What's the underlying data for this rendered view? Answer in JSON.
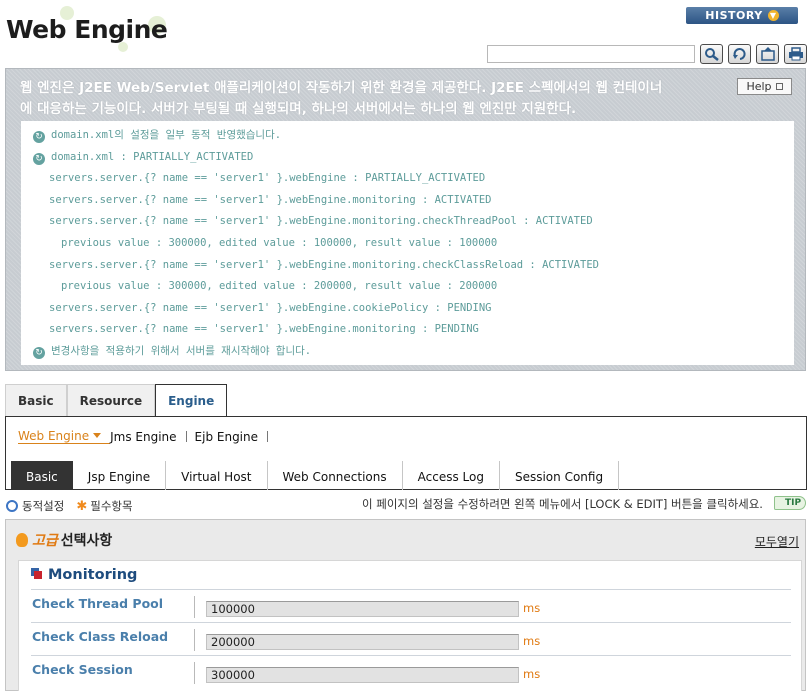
{
  "header": {
    "title": "Web Engine",
    "history_label": "HISTORY",
    "search_value": "",
    "toolbar_icons": [
      "search-icon",
      "refresh-icon",
      "export-icon",
      "print-icon"
    ]
  },
  "description": {
    "lines": [
      "웹 엔진은 J2EE Web/Servlet 애플리케이션이 작동하기 위한 환경을 제공한다. J2EE 스펙에서의 웹 컨테이너",
      "에 대응하는 기능이다. 서버가 부팅될 때 실행되며, 하나의 서버에서는 하나의 웹 엔진만 지원한다."
    ],
    "help_label": "Help"
  },
  "messages": [
    {
      "icon": true,
      "indent": 0,
      "text": "domain.xml의 설정을 일부 동적 반영했습니다."
    },
    {
      "icon": true,
      "indent": 0,
      "text": "domain.xml : PARTIALLY_ACTIVATED"
    },
    {
      "icon": false,
      "indent": 1,
      "text": "servers.server.{? name == 'server1' }.webEngine : PARTIALLY_ACTIVATED"
    },
    {
      "icon": false,
      "indent": 1,
      "text": "servers.server.{? name == 'server1' }.webEngine.monitoring : ACTIVATED"
    },
    {
      "icon": false,
      "indent": 1,
      "text": "servers.server.{? name == 'server1' }.webEngine.monitoring.checkThreadPool : ACTIVATED"
    },
    {
      "icon": false,
      "indent": 2,
      "text": "previous value : 300000, edited value : 100000, result value : 100000"
    },
    {
      "icon": false,
      "indent": 1,
      "text": "servers.server.{? name == 'server1' }.webEngine.monitoring.checkClassReload : ACTIVATED"
    },
    {
      "icon": false,
      "indent": 2,
      "text": "previous value : 300000, edited value : 200000, result value : 200000"
    },
    {
      "icon": false,
      "indent": 1,
      "text": "servers.server.{? name == 'server1' }.webEngine.cookiePolicy : PENDING"
    },
    {
      "icon": false,
      "indent": 1,
      "text": "servers.server.{? name == 'server1' }.webEngine.monitoring : PENDING"
    },
    {
      "icon": true,
      "indent": 0,
      "text": "변경사항을 적용하기 위해서 서버를 재시작해야 합니다."
    }
  ],
  "main_tabs": [
    {
      "label": "Basic",
      "active": false
    },
    {
      "label": "Resource",
      "active": false
    },
    {
      "label": "Engine",
      "active": true
    }
  ],
  "sub_tabs": [
    {
      "label": "Web Engine",
      "active": true
    },
    {
      "label": "Jms Engine",
      "active": false
    },
    {
      "label": "Ejb Engine",
      "active": false
    }
  ],
  "section_tabs": [
    {
      "label": "Basic",
      "active": true
    },
    {
      "label": "Jsp Engine",
      "active": false
    },
    {
      "label": "Virtual Host",
      "active": false
    },
    {
      "label": "Web Connections",
      "active": false
    },
    {
      "label": "Access Log",
      "active": false
    },
    {
      "label": "Session Config",
      "active": false
    }
  ],
  "legend": {
    "dynamic_label": "동적설정",
    "required_label": "필수항목",
    "tip_text": "이 페이지의 설정을 수정하려면 왼쪽 메뉴에서 [LOCK & EDIT] 버튼을 클릭하세요.",
    "tip_badge": "TIP"
  },
  "advanced": {
    "highlight": "고급",
    "title": "선택사항",
    "expand_all": "모두열기",
    "section_title": "Monitoring",
    "fields": [
      {
        "label": "Check Thread Pool",
        "value": "100000",
        "unit": "ms"
      },
      {
        "label": "Check Class Reload",
        "value": "200000",
        "unit": "ms"
      },
      {
        "label": "Check Session",
        "value": "300000",
        "unit": "ms"
      }
    ]
  }
}
